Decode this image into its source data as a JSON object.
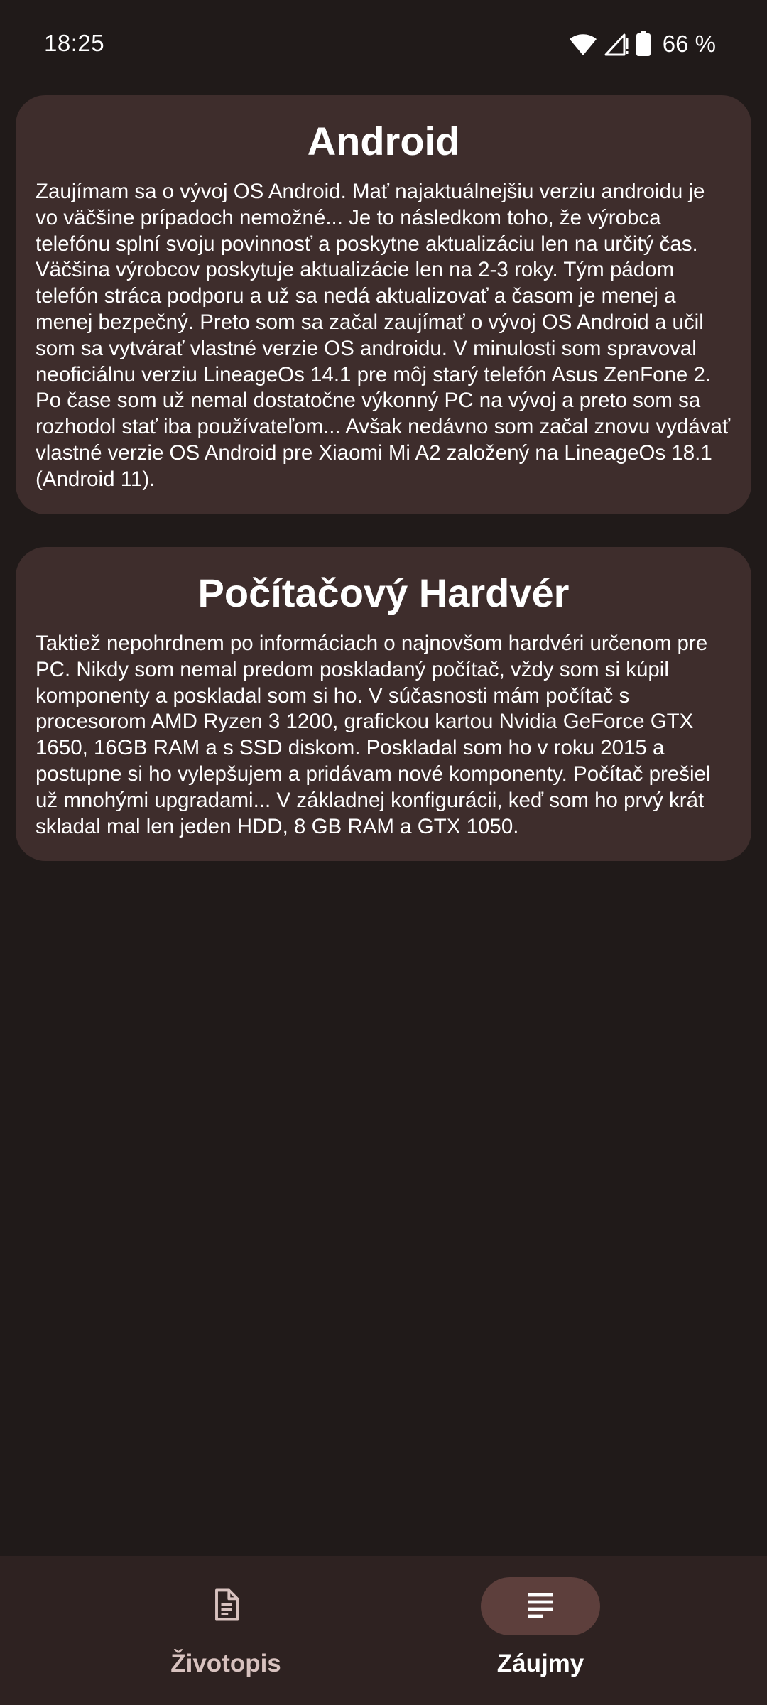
{
  "status_bar": {
    "time": "18:25",
    "battery": "66 %",
    "icons": [
      "wifi-icon",
      "signal-icon",
      "battery-icon"
    ]
  },
  "cards": [
    {
      "title": "Android",
      "body": "Zaujímam sa o vývoj OS Android. Mať najaktuálnejšiu verziu androidu je vo väčšine prípadoch nemožné... Je to následkom toho, že výrobca telefónu splní svoju povinnosť a poskytne aktualizáciu len na určitý čas. Väčšina výrobcov poskytuje aktualizácie len na 2-3 roky. Tým pádom telefón stráca podporu a už sa nedá aktualizovať a časom je menej a menej bezpečný. Preto som sa začal zaujímať o vývoj OS Android a učil som sa vytvárať vlastné verzie OS androidu. V minulosti som spravoval neoficiálnu verziu LineageOs 14.1 pre môj starý telefón Asus ZenFone 2. Po čase som už nemal dostatočne výkonný PC na vývoj a preto som sa rozhodol stať iba používateľom... Avšak nedávno som začal znovu vydávať vlastné verzie OS Android pre Xiaomi Mi A2 založený na LineageOs 18.1 (Android 11)."
    },
    {
      "title": "Počítačový Hardvér",
      "body": "Taktiež nepohrdnem po informáciach o najnovšom hardvéri určenom pre PC. Nikdy som nemal predom poskladaný počítač, vždy som si kúpil komponenty a poskladal som si ho. V súčasnosti mám počítač s procesorom AMD Ryzen 3 1200, grafickou kartou Nvidia GeForce GTX 1650, 16GB RAM a s SSD diskom. Poskladal som ho v roku 2015 a postupne si ho vylepšujem a pridávam nové komponenty. Počítač prešiel už mnohými upgradami... V základnej konfigurácii, keď som ho prvý krát skladal mal len jeden HDD, 8 GB RAM a GTX 1050."
    }
  ],
  "bottom_nav": {
    "items": [
      {
        "label": "Životopis",
        "icon": "document-icon",
        "selected": false
      },
      {
        "label": "Záujmy",
        "icon": "text-lines-icon",
        "selected": true
      }
    ]
  },
  "colors": {
    "background": "#201a19",
    "card": "#3e2d2c",
    "nav_background": "#2e2221",
    "nav_indicator": "#5d3f3c"
  }
}
